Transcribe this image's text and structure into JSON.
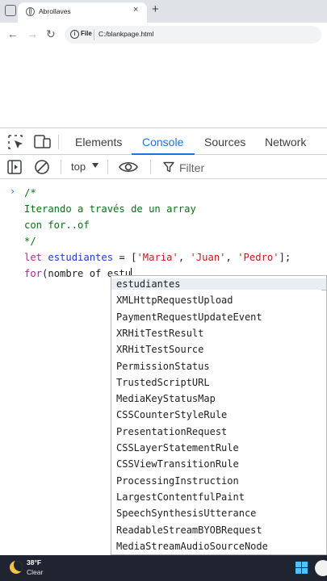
{
  "browser": {
    "tab_title": "Abrollaves",
    "tab_close": "×",
    "new_tab": "+",
    "nav_back": "←",
    "nav_forward": "→",
    "nav_reload": "↻",
    "omnibox_label": "File",
    "url": "C:/blankpage.html"
  },
  "devtools": {
    "tabs": [
      "Elements",
      "Console",
      "Sources",
      "Network"
    ],
    "active_tab": "Console",
    "context": "top",
    "filter_placeholder": "Filter"
  },
  "console": {
    "prompt": "›",
    "lines": [
      [
        {
          "t": "cmt",
          "v": "/*"
        }
      ],
      [
        {
          "t": "cmt",
          "v": "Iterando a través de un array"
        }
      ],
      [
        {
          "t": "cmt",
          "v": "con for..of"
        }
      ],
      [
        {
          "t": "cmt",
          "v": "*/"
        }
      ],
      [
        {
          "t": "kw",
          "v": "let "
        },
        {
          "t": "var",
          "v": "estudiantes"
        },
        {
          "t": "pl",
          "v": " = ["
        },
        {
          "t": "str",
          "v": "'Maria'"
        },
        {
          "t": "pl",
          "v": ", "
        },
        {
          "t": "str",
          "v": "'Juan'"
        },
        {
          "t": "pl",
          "v": ", "
        },
        {
          "t": "str",
          "v": "'Pedro'"
        },
        {
          "t": "pl",
          "v": "];"
        }
      ],
      [
        {
          "t": "kw",
          "v": "for"
        },
        {
          "t": "pl",
          "v": "(nombre of estu"
        }
      ]
    ],
    "autocomplete": [
      "estudiantes",
      "XMLHttpRequestUpload",
      "PaymentRequestUpdateEvent",
      "XRHitTestResult",
      "XRHitTestSource",
      "PermissionStatus",
      "TrustedScriptURL",
      "MediaKeyStatusMap",
      "CSSCounterStyleRule",
      "PresentationRequest",
      "CSSLayerStatementRule",
      "CSSViewTransitionRule",
      "ProcessingInstruction",
      "LargestContentfulPaint",
      "SpeechSynthesisUtterance",
      "ReadableStreamBYOBRequest",
      "MediaStreamAudioSourceNode"
    ],
    "autocomplete_selected": 0
  },
  "taskbar": {
    "temperature": "38°F",
    "weather": "Clear",
    "accent": "#4cc2ff"
  },
  "colors": {
    "accent_blue": "#1a73e8",
    "comment_green": "#0b6f18",
    "keyword_purple": "#a52a9a",
    "string_red": "#c41a16"
  }
}
